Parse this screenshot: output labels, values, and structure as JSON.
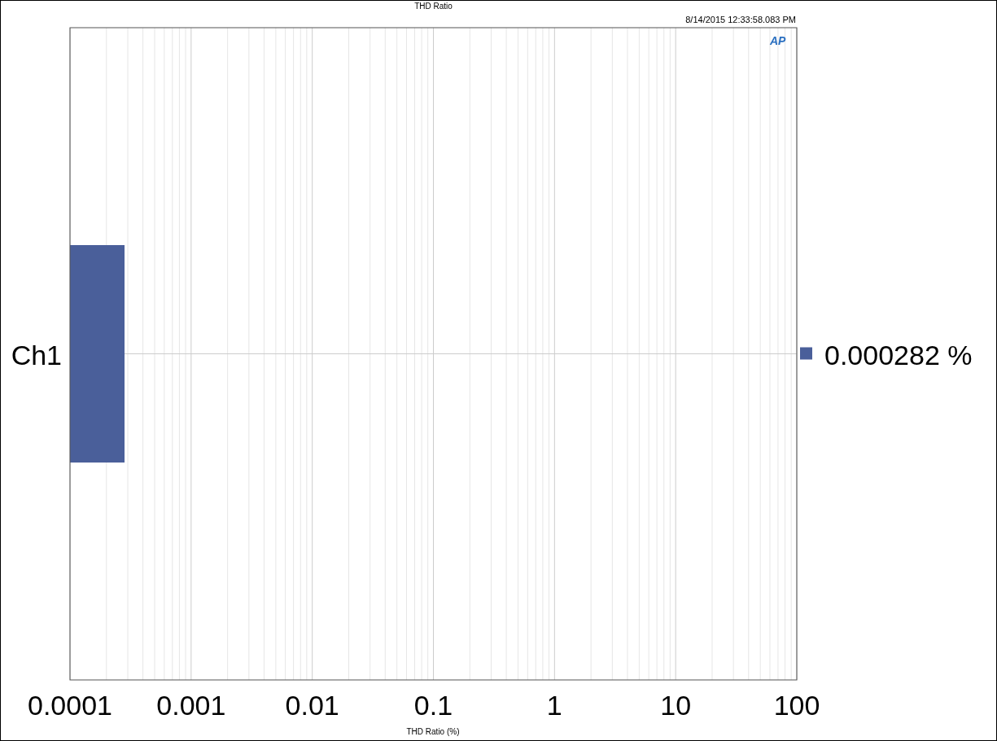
{
  "title": "THD Ratio",
  "timestamp": "8/14/2015 12:33:58.083 PM",
  "logo": "AP",
  "bars": [
    {
      "label": "Ch1",
      "value_label": "0.000282 %",
      "color": "#4a5f9a"
    }
  ],
  "x_axis": {
    "title": "THD Ratio (%)",
    "tick_labels": [
      "0.0001",
      "0.001",
      "0.01",
      "0.1",
      "1",
      "10",
      "100"
    ]
  }
}
